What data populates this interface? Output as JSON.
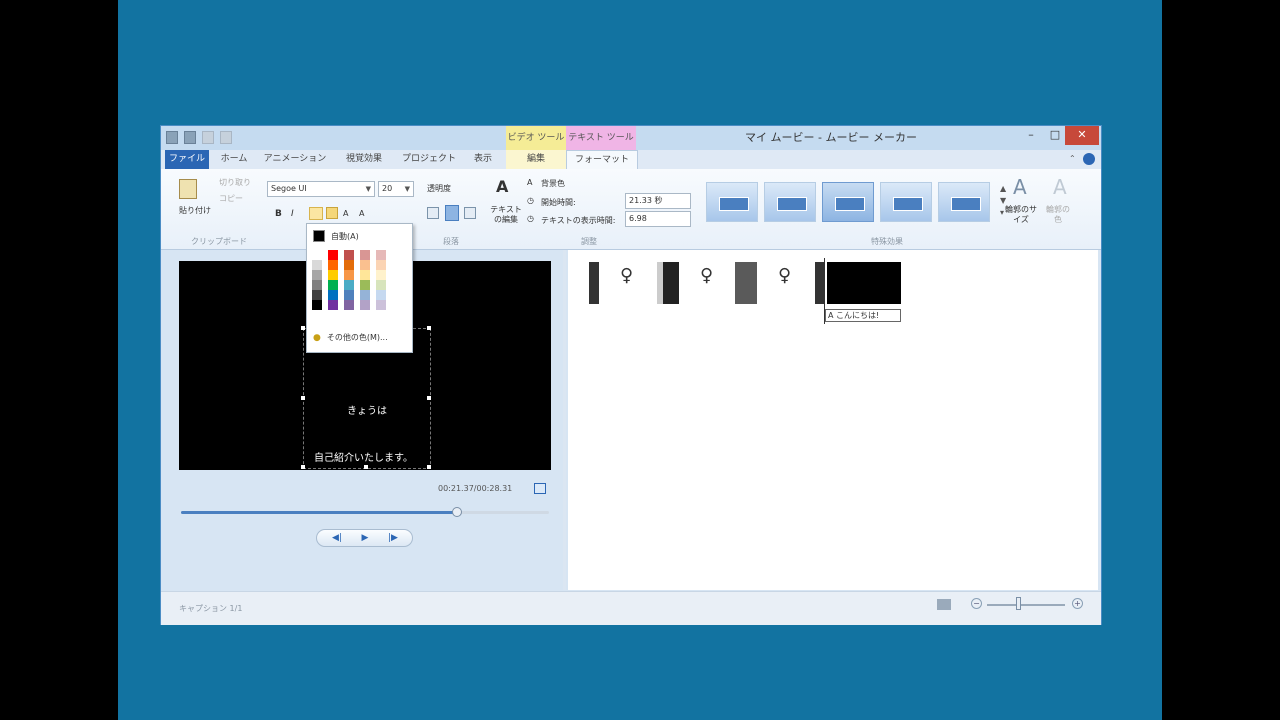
{
  "window": {
    "title": "マイ ムービー - ムービー メーカー",
    "context_video": "ビデオ ツール",
    "context_text": "テキスト ツール",
    "minimize": "–",
    "maximize": "□",
    "close": "✕"
  },
  "tabs": [
    "ファイル",
    "ホーム",
    "アニメーション",
    "視覚効果",
    "プロジェクト",
    "表示",
    "編集",
    "フォーマット"
  ],
  "ribbon": {
    "clipboard": {
      "paste": "貼り付け",
      "cut": "切り取り",
      "copy": "コピー",
      "group": "クリップボード"
    },
    "font": {
      "family": "Segoe UI",
      "size": "20",
      "bold": "B",
      "italic": "I",
      "transparency": "透明度"
    },
    "paragraph": {
      "group": "段落"
    },
    "adjust": {
      "edit_text": "テキストの編集",
      "bg_color": "背景色",
      "start_time_label": "開始時間:",
      "start_time_value": "21.33 秒",
      "duration_label": "テキストの表示時間:",
      "duration_value": "6.98",
      "group": "調整"
    },
    "effects": {
      "group": "特殊効果",
      "outline_size": "輪郭のサイズ",
      "outline_color": "輪郭の色"
    }
  },
  "color_menu": {
    "auto": "自動(A)",
    "more": "その他の色(M)...",
    "palette": [
      [
        "#ffffff",
        "#d9d9d9",
        "#a6a6a6",
        "#7f7f7f",
        "#404040",
        "#000000"
      ],
      [
        "#ff0000",
        "#ff6600",
        "#ffcc00",
        "#00b050",
        "#0070c0",
        "#7030a0"
      ],
      [
        "#c0504d",
        "#e36c09",
        "#f79646",
        "#4bacc6",
        "#4f81bd",
        "#8064a2"
      ],
      [
        "#d99694",
        "#fac08f",
        "#ffe699",
        "#9bbb59",
        "#95b3d7",
        "#b2a2c7"
      ],
      [
        "#e6b9b8",
        "#fbd4b4",
        "#fff2cc",
        "#d7e4bc",
        "#c6d9f0",
        "#ccc1da"
      ]
    ]
  },
  "preview": {
    "line1": "きょうは",
    "line2": "自己紹介いたします。",
    "timecode": "00:21.37/00:28.31",
    "progress": 0.75
  },
  "controls": {
    "prev": "◀|",
    "play": "▶",
    "next": "|▶"
  },
  "storyboard": {
    "caption_clip": "A こんにちは!"
  },
  "status": {
    "text": "キャプション 1/1",
    "zoom_out": "−",
    "zoom_in": "+"
  }
}
